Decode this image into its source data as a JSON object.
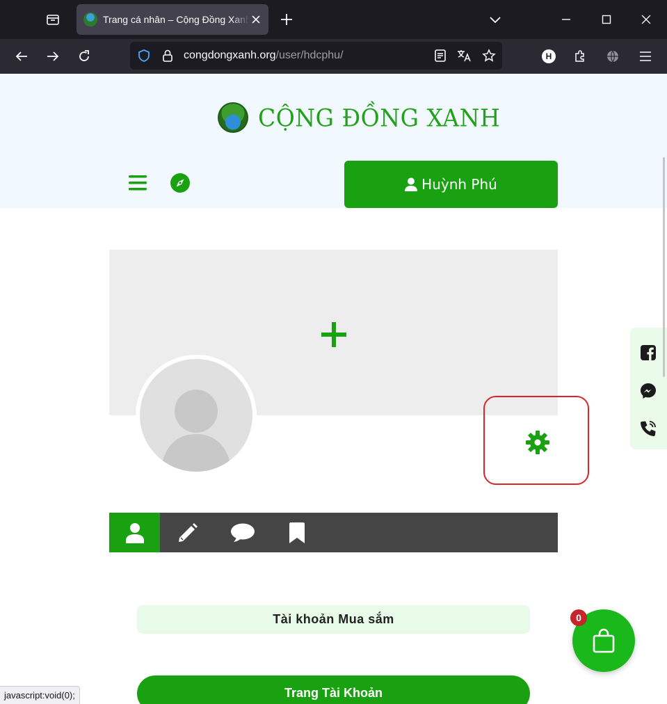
{
  "browser": {
    "tab_title": "Trang cá nhân – Cộng Đồng Xanh",
    "url_domain": "congdongxanh.org",
    "url_path": "/user/hdcphu/",
    "profile_initial": "H",
    "status_text": "javascript:void(0);"
  },
  "site": {
    "logo_text": "CỘNG ĐỒNG XANH",
    "user_name": "Huỳnh Phú"
  },
  "profile": {
    "shop_section_title": "Tài khoản Mua sắm",
    "account_button": "Trang Tài Khoản",
    "cart_count": "0"
  },
  "colors": {
    "brand_green": "#1aa112",
    "highlight_red": "#d9252a",
    "badge_red": "#c4262b"
  },
  "icons": {
    "profile_tabs": [
      "user-icon",
      "pencil-icon",
      "comment-icon",
      "bookmark-icon"
    ],
    "social": [
      "facebook-icon",
      "messenger-icon",
      "phone-icon"
    ]
  }
}
